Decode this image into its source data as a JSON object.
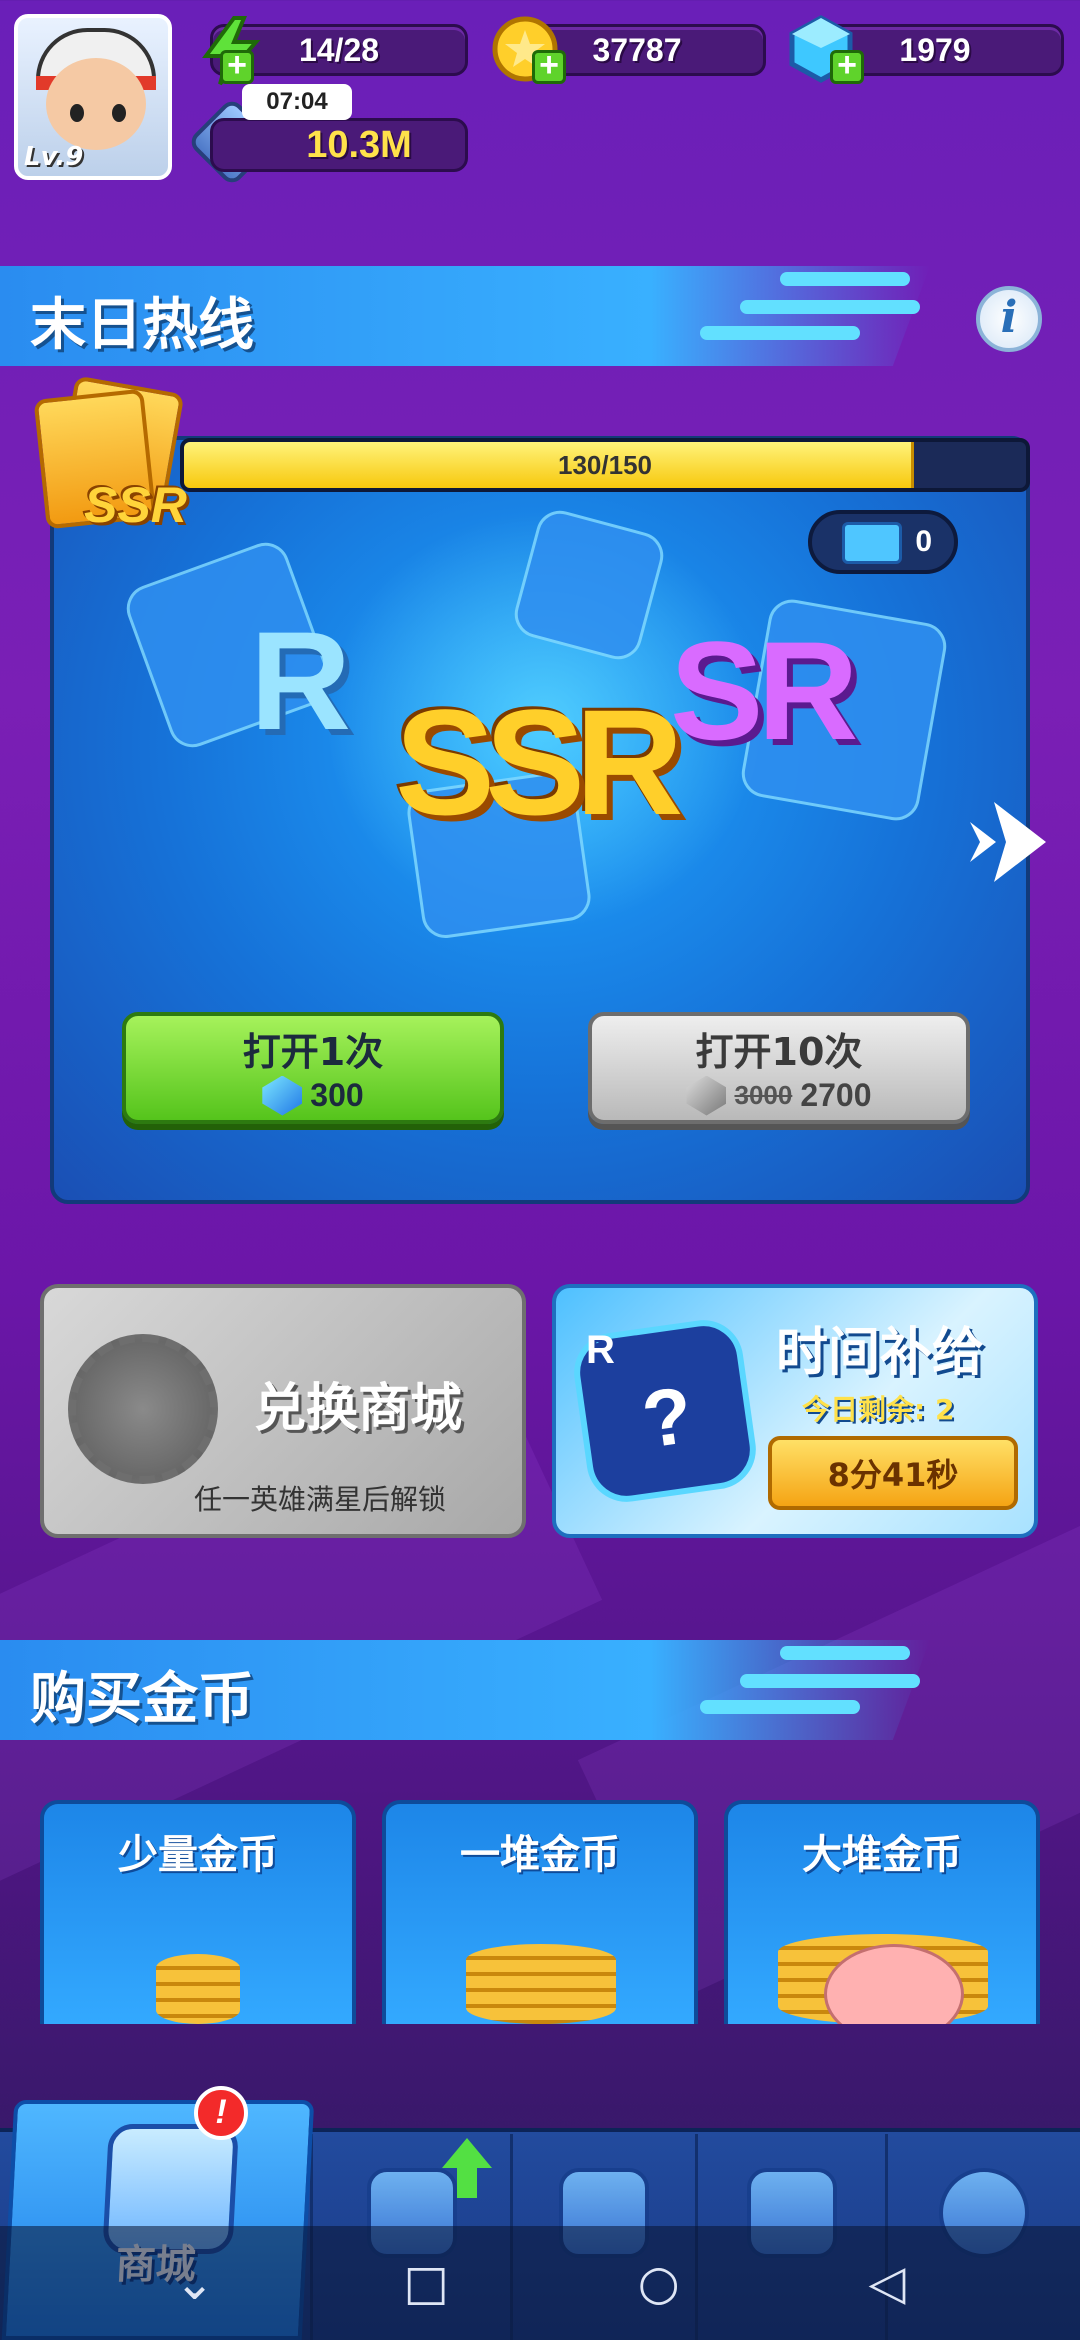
{
  "player": {
    "level": "Lv.9"
  },
  "resources": {
    "energy": "14/28",
    "coins": "37787",
    "gems": "1979",
    "timer": "07:04",
    "power": "10.3M"
  },
  "gacha": {
    "title": "末日热线",
    "info_label": "i",
    "progress_text": "130/150",
    "progress_value": 130,
    "progress_max": 150,
    "ticket_count": "0",
    "rarity_r": "R",
    "rarity_ssr": "SSR",
    "rarity_sr": "SR",
    "badge_label": "SSR",
    "open1_label": "打开1次",
    "open1_price": "300",
    "open10_label": "打开10次",
    "open10_old_price": "3000",
    "open10_price": "2700"
  },
  "exchange": {
    "title": "兑换商城",
    "subtitle": "任一英雄满星后解锁"
  },
  "time_supply": {
    "badge": "R",
    "title": "时间补给",
    "remaining": "今日剩余: 2",
    "countdown": "8分41秒"
  },
  "buy_coins": {
    "title": "购买金币",
    "items": [
      {
        "label": "少量金币"
      },
      {
        "label": "一堆金币"
      },
      {
        "label": "大堆金币"
      }
    ]
  },
  "nav": {
    "shop_label": "商城",
    "alert": "!"
  },
  "colors": {
    "accent_green": "#55c41c",
    "gold": "#f7c80d",
    "panel_blue": "#1672d8",
    "purple_bg": "#6a1fb8"
  }
}
